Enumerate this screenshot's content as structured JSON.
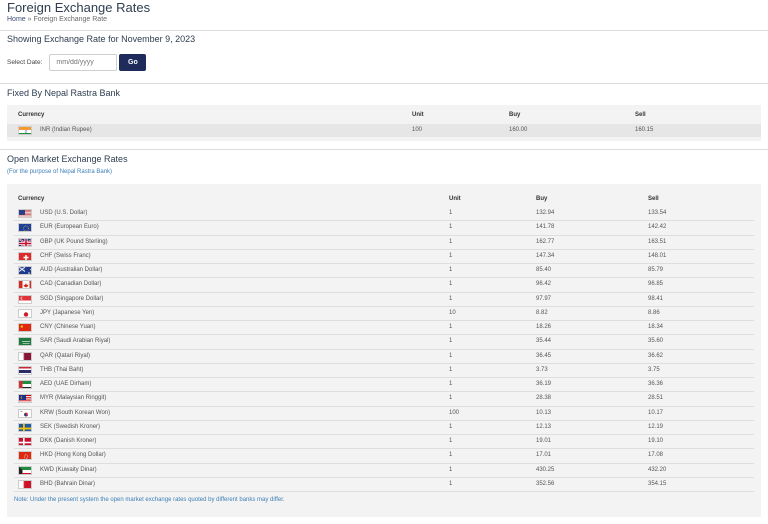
{
  "header": {
    "title": "Foreign Exchange Rates",
    "breadcrumb_home": "Home",
    "breadcrumb_separator": " » ",
    "breadcrumb_current": "Foreign Exchange Rate"
  },
  "date_section": {
    "heading": "Showing Exchange Rate for November 9, 2023",
    "label": "Select Date:",
    "placeholder": "mm/dd/yyyy",
    "go_label": "Go"
  },
  "fixed": {
    "heading": "Fixed By Nepal Rastra Bank",
    "columns": [
      "Currency",
      "Unit",
      "Buy",
      "Sell"
    ],
    "rows": [
      {
        "flag": "india-flag",
        "currency": "INR (Indian Rupee)",
        "unit": "100",
        "buy": "160.00",
        "sell": "160.15"
      }
    ]
  },
  "open_market": {
    "heading": "Open Market Exchange Rates",
    "subtitle": "(For the purpose of Nepal Rastra Bank)",
    "columns": [
      "Currency",
      "Unit",
      "Buy",
      "Sell"
    ],
    "rows": [
      {
        "flag": "us-flag",
        "currency": "USD (U.S. Dollar)",
        "unit": "1",
        "buy": "132.94",
        "sell": "133.54"
      },
      {
        "flag": "eu-flag",
        "currency": "EUR (European Euro)",
        "unit": "1",
        "buy": "141.78",
        "sell": "142.42"
      },
      {
        "flag": "uk-flag",
        "currency": "GBP (UK Pound Sterling)",
        "unit": "1",
        "buy": "162.77",
        "sell": "163.51"
      },
      {
        "flag": "swiss-flag",
        "currency": "CHF (Swiss Franc)",
        "unit": "1",
        "buy": "147.34",
        "sell": "148.01"
      },
      {
        "flag": "australia-flag",
        "currency": "AUD (Australian Dollar)",
        "unit": "1",
        "buy": "85.40",
        "sell": "85.79"
      },
      {
        "flag": "canada-flag",
        "currency": "CAD (Canadian Dollar)",
        "unit": "1",
        "buy": "96.42",
        "sell": "96.85"
      },
      {
        "flag": "singapore-flag",
        "currency": "SGD (Singapore Dollar)",
        "unit": "1",
        "buy": "97.97",
        "sell": "98.41"
      },
      {
        "flag": "japan-flag",
        "currency": "JPY (Japanese Yen)",
        "unit": "10",
        "buy": "8.82",
        "sell": "8.86"
      },
      {
        "flag": "china-flag",
        "currency": "CNY (Chinese Yuan)",
        "unit": "1",
        "buy": "18.26",
        "sell": "18.34"
      },
      {
        "flag": "saudi-flag",
        "currency": "SAR (Saudi Arabian Riyal)",
        "unit": "1",
        "buy": "35.44",
        "sell": "35.60"
      },
      {
        "flag": "qatar-flag",
        "currency": "QAR (Qatari Riyal)",
        "unit": "1",
        "buy": "36.45",
        "sell": "36.62"
      },
      {
        "flag": "thailand-flag",
        "currency": "THB (Thai Baht)",
        "unit": "1",
        "buy": "3.73",
        "sell": "3.75"
      },
      {
        "flag": "uae-flag",
        "currency": "AED (UAE Dirham)",
        "unit": "1",
        "buy": "36.19",
        "sell": "36.36"
      },
      {
        "flag": "malaysia-flag",
        "currency": "MYR (Malaysian Ringgit)",
        "unit": "1",
        "buy": "28.38",
        "sell": "28.51"
      },
      {
        "flag": "korea-flag",
        "currency": "KRW (South Korean Won)",
        "unit": "100",
        "buy": "10.13",
        "sell": "10.17"
      },
      {
        "flag": "sweden-flag",
        "currency": "SEK (Swedish Kroner)",
        "unit": "1",
        "buy": "12.13",
        "sell": "12.19"
      },
      {
        "flag": "denmark-flag",
        "currency": "DKK (Danish Kroner)",
        "unit": "1",
        "buy": "19.01",
        "sell": "19.10"
      },
      {
        "flag": "hongkong-flag",
        "currency": "HKD (Hong Kong Dollar)",
        "unit": "1",
        "buy": "17.01",
        "sell": "17.08"
      },
      {
        "flag": "kuwait-flag",
        "currency": "KWD (Kuwaity Dinar)",
        "unit": "1",
        "buy": "430.25",
        "sell": "432.20"
      },
      {
        "flag": "bahrain-flag",
        "currency": "BHD (Bahrain Dinar)",
        "unit": "1",
        "buy": "352.56",
        "sell": "354.15"
      }
    ],
    "note": "Note: Under the present system the open market exchange rates quoted by different banks may differ."
  },
  "colors": {
    "title": "#2e3d4f",
    "button": "#1f2b5b",
    "link": "#3d7fb6",
    "panel": "#f3f3f3"
  }
}
